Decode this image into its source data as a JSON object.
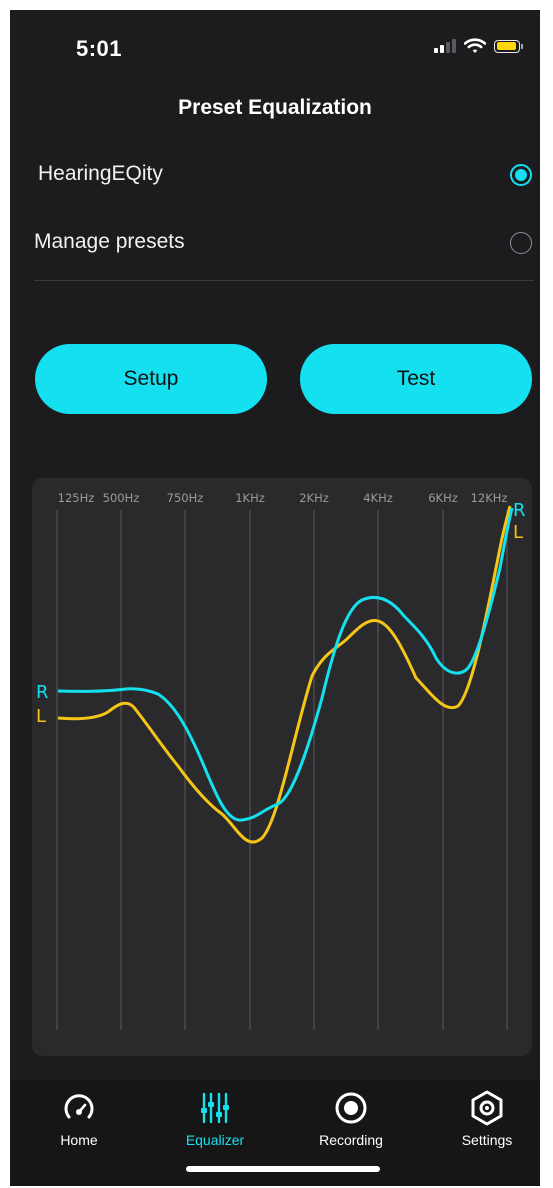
{
  "status": {
    "time": "5:01"
  },
  "title": "Preset Equalization",
  "options": [
    {
      "label": "HearingEQity",
      "selected": true
    },
    {
      "label": "Manage presets",
      "selected": false
    }
  ],
  "buttons": {
    "setup": "Setup",
    "test": "Test"
  },
  "eq": {
    "frequencies": [
      "125Hz",
      "500Hz",
      "750Hz",
      "1KHz",
      "2KHz",
      "4KHz",
      "6KHz",
      "12KHz"
    ],
    "right_label": "R",
    "left_label": "L",
    "colors": {
      "right": "#14e0f0",
      "left": "#f5c518"
    }
  },
  "tabs": [
    {
      "label": "Home",
      "icon": "gauge-icon",
      "active": false
    },
    {
      "label": "Equalizer",
      "icon": "sliders-icon",
      "active": true
    },
    {
      "label": "Recording",
      "icon": "record-icon",
      "active": false
    },
    {
      "label": "Settings",
      "icon": "gear-icon",
      "active": false
    }
  ],
  "accent": "#14e0f0"
}
